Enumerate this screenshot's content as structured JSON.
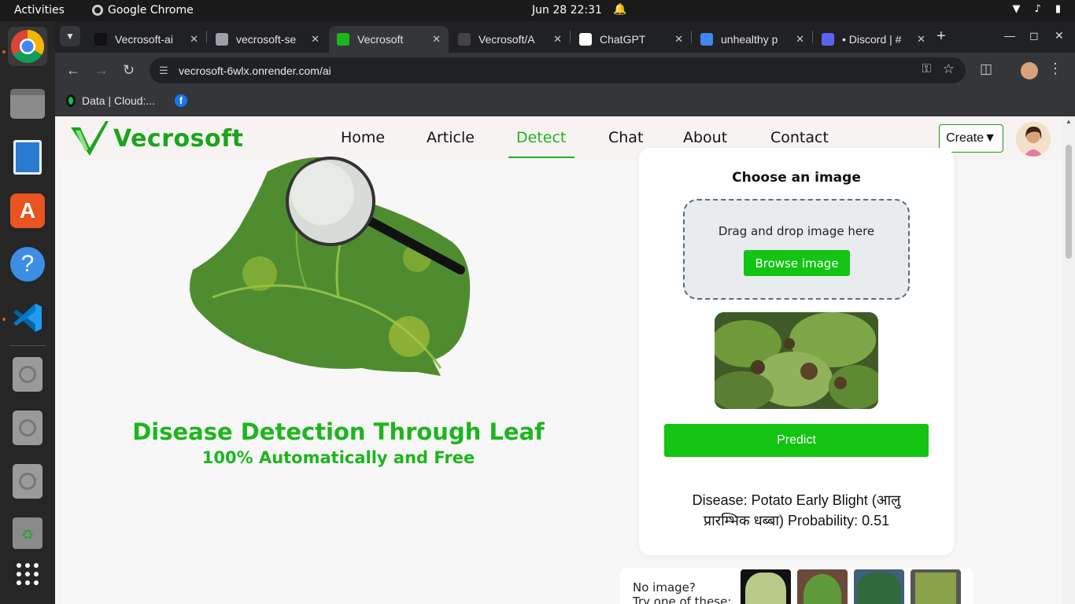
{
  "os": {
    "activities": "Activities",
    "app_name": "Google Chrome",
    "clock": "Jun 28  22:31"
  },
  "browser": {
    "tabs": [
      {
        "title": "Vecrosoft-ai",
        "favicon_color": "#111111"
      },
      {
        "title": "vecrosoft-se",
        "favicon_color": "#9aa0a6"
      },
      {
        "title": "Vecrosoft",
        "favicon_color": "#1db51d"
      },
      {
        "title": "Vecrosoft/A",
        "favicon_color": "#444444"
      },
      {
        "title": "ChatGPT",
        "favicon_color": "#ffffff"
      },
      {
        "title": "unhealthy p",
        "favicon_color": "#4285f4"
      },
      {
        "title": "• Discord | #",
        "favicon_color": "#5865f2"
      }
    ],
    "active_tab_index": 2,
    "url": "vecrosoft-6wlx.onrender.com/ai",
    "bookmarks": [
      {
        "label": "Data | Cloud:..."
      }
    ]
  },
  "site": {
    "logo_text": "Vecrosoft",
    "nav": [
      {
        "label": "Home",
        "active": false
      },
      {
        "label": "Article",
        "active": false
      },
      {
        "label": "Detect",
        "active": true
      },
      {
        "label": "Chat",
        "active": false
      },
      {
        "label": "About",
        "active": false
      },
      {
        "label": "Contact",
        "active": false
      }
    ],
    "create_label": "Create▼",
    "brand_color": "#1db51d",
    "hero": {
      "title": "Disease Detection Through Leaf",
      "subtitle": "100% Automatically and Free"
    },
    "upload": {
      "heading": "Choose an image",
      "dropzone_text": "Drag and drop image here",
      "browse_label": "Browse image",
      "predict_label": "Predict",
      "result_text": "Disease: Potato Early Blight (आलु प्रारम्भिक धब्बा) Probability: 0.51"
    },
    "samples": {
      "label_line1": "No image?",
      "label_line2": "Try one of these:"
    }
  }
}
